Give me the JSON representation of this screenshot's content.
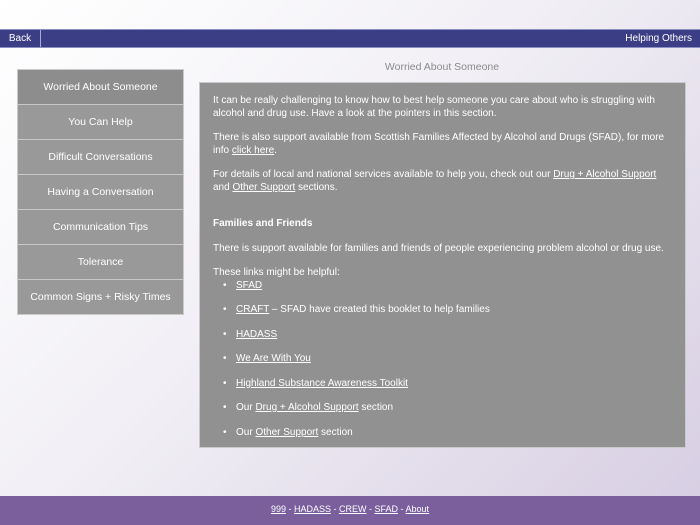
{
  "topbar": {
    "back_label": "Back",
    "title": "Helping Others"
  },
  "sidebar": {
    "items": [
      {
        "label": "Worried About Someone"
      },
      {
        "label": "You Can Help"
      },
      {
        "label": "Difficult Conversations"
      },
      {
        "label": "Having a Conversation"
      },
      {
        "label": "Communication Tips"
      },
      {
        "label": "Tolerance"
      },
      {
        "label": "Common Signs + Risky Times"
      }
    ]
  },
  "main": {
    "heading": "Worried About Someone",
    "para1": "It can be really challenging to know how to best help someone you care about who is struggling with alcohol and drug use. Have a look at the pointers in this section.",
    "para2_pre": "There is also support available from Scottish Families Affected by Alcohol and Drugs (SFAD), for more info ",
    "para2_link": "click here",
    "para2_post": ".",
    "para3_pre": "For details of local and national services available to help you, check out our ",
    "para3_link1": "Drug + Alcohol Support",
    "para3_mid": " and ",
    "para3_link2": "Other Support",
    "para3_post": " sections.",
    "section_heading": "Families and Friends",
    "para4": "There is support available for families and friends of people experiencing problem alcohol or drug use.",
    "links_intro": "These links might be helpful:",
    "bullet": "•",
    "links": [
      {
        "pre": "",
        "link": "SFAD",
        "post": ""
      },
      {
        "pre": "",
        "link": "CRAFT",
        "post": " – SFAD have created this booklet to help families"
      },
      {
        "pre": "",
        "link": "HADASS",
        "post": ""
      },
      {
        "pre": "",
        "link": "We Are With You",
        "post": ""
      },
      {
        "pre": "",
        "link": "Highland Substance Awareness Toolkit",
        "post": ""
      },
      {
        "pre": "Our ",
        "link": "Drug + Alcohol Support",
        "post": " section"
      },
      {
        "pre": "Our ",
        "link": "Other Support",
        "post": " section"
      }
    ]
  },
  "footer": {
    "links": [
      "999",
      "HADASS",
      "CREW",
      "SFAD",
      "About"
    ],
    "separator": " - "
  }
}
